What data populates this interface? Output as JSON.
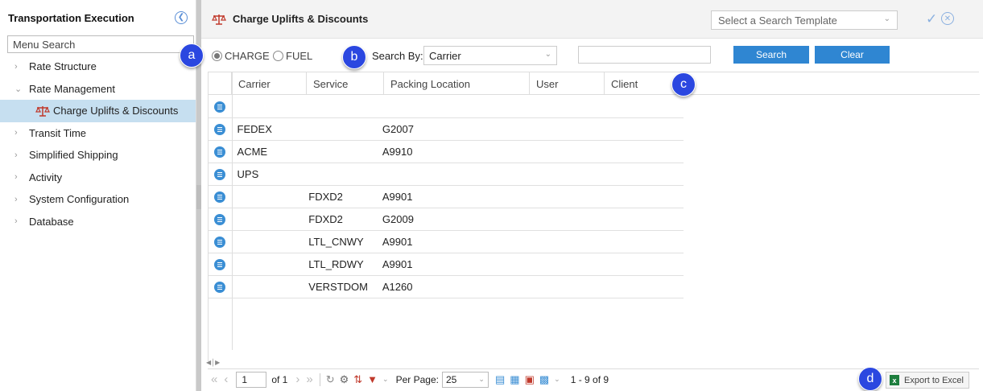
{
  "sidebar": {
    "title": "Transportation Execution",
    "search_placeholder": "Menu Search",
    "items": [
      {
        "label": "Rate Structure",
        "expanded": false
      },
      {
        "label": "Rate Management",
        "expanded": true
      },
      {
        "label": "Charge Uplifts & Discounts",
        "selected": true
      },
      {
        "label": "Transit Time",
        "expanded": false
      },
      {
        "label": "Simplified Shipping",
        "expanded": false
      },
      {
        "label": "Activity",
        "expanded": false
      },
      {
        "label": "System Configuration",
        "expanded": false
      },
      {
        "label": "Database",
        "expanded": false
      }
    ]
  },
  "header": {
    "title": "Charge Uplifts & Discounts",
    "template_placeholder": "Select a Search Template"
  },
  "toolbar": {
    "radio_charge": "CHARGE",
    "radio_fuel": "FUEL",
    "selected_radio": "CHARGE",
    "search_by_label": "Search By:",
    "search_by_value": "Carrier",
    "search_text": "",
    "search_button": "Search",
    "clear_button": "Clear"
  },
  "grid": {
    "columns": [
      "Carrier",
      "Service",
      "Packing Location",
      "User",
      "Client"
    ],
    "rows": [
      [
        "",
        "",
        "",
        "",
        ""
      ],
      [
        "FEDEX",
        "",
        "G2007",
        "",
        ""
      ],
      [
        "ACME",
        "",
        "A9910",
        "",
        ""
      ],
      [
        "UPS",
        "",
        "",
        "",
        ""
      ],
      [
        "",
        "FDXD2",
        "A9901",
        "",
        ""
      ],
      [
        "",
        "FDXD2",
        "G2009",
        "",
        ""
      ],
      [
        "",
        "LTL_CNWY",
        "A9901",
        "",
        ""
      ],
      [
        "",
        "LTL_RDWY",
        "A9901",
        "",
        ""
      ],
      [
        "",
        "VERSTDOM",
        "A1260",
        "",
        ""
      ]
    ]
  },
  "pager": {
    "page": "1",
    "of_label": "of 1",
    "per_page_label": "Per Page:",
    "per_page_value": "25",
    "count_label": "1 - 9 of 9",
    "export_label": "Export to Excel"
  },
  "callouts": {
    "a": "a",
    "b": "b",
    "c": "c",
    "d": "d"
  },
  "colors": {
    "accent": "#2f86d2",
    "selected_bg": "#c6dff0",
    "callout": "#2b47e0"
  }
}
